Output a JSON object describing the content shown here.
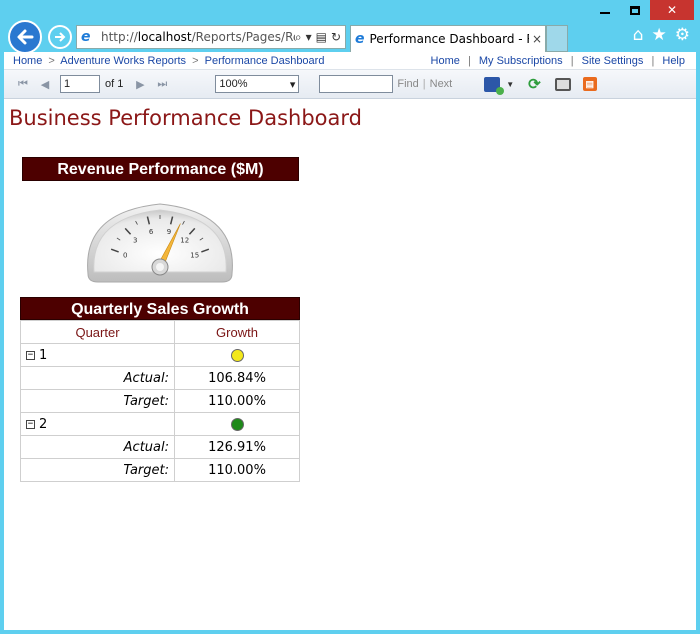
{
  "browser": {
    "url_prefix": "http://",
    "url_host": "localhost",
    "url_path": "/Reports/Pages/Rep",
    "tab_title": "Performance Dashboard - R...",
    "tab_close": "×"
  },
  "breadcrumb": {
    "home": "Home",
    "folder": "Adventure Works Reports",
    "current": "Performance Dashboard",
    "separator": ">"
  },
  "site_links": {
    "home": "Home",
    "subscriptions": "My Subscriptions",
    "settings": "Site Settings",
    "help": "Help"
  },
  "toolbar": {
    "page_value": "1",
    "of_label": "of 1",
    "zoom_value": "100%",
    "find_label": "Find",
    "divider": "|",
    "next_label": "Next"
  },
  "report": {
    "title": "Business Performance Dashboard",
    "revenue_header": "Revenue Performance ($M)",
    "gauge": {
      "min": 0,
      "max": 15,
      "tick_labels": [
        "0",
        "3",
        "6",
        "9",
        "12",
        "15"
      ],
      "needle_value": 10.2
    },
    "growth_header": "Quarterly Sales Growth",
    "columns": [
      "Quarter",
      "Growth"
    ],
    "quarters": [
      {
        "label": "1",
        "indicator_color": "#f3e81b",
        "actual_label": "Actual:",
        "actual_value": "106.84%",
        "target_label": "Target:",
        "target_value": "110.00%"
      },
      {
        "label": "2",
        "indicator_color": "#1f8a1a",
        "actual_label": "Actual:",
        "actual_value": "126.91%",
        "target_label": "Target:",
        "target_value": "110.00%"
      }
    ]
  },
  "colors": {
    "header_bg": "#4d0000",
    "title": "#8b1717",
    "link": "#1a47a6",
    "chrome": "#5ecfef"
  }
}
